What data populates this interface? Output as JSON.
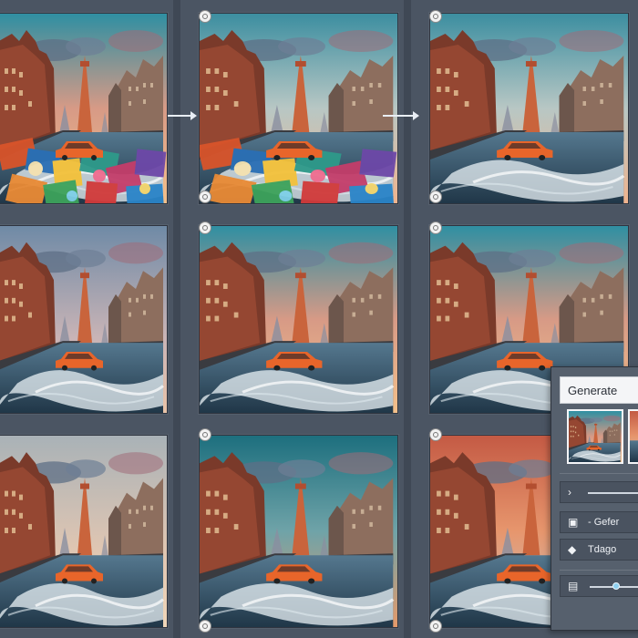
{
  "panel": {
    "title": "Generate",
    "rows": [
      {
        "icon": "chevron-right-icon",
        "label": ""
      },
      {
        "icon": "image-frame-icon",
        "label": "- Gefer"
      },
      {
        "icon": "diamond-split-icon",
        "label": "Tdago"
      },
      {
        "icon": "slider-icon",
        "label": ""
      }
    ],
    "slider_value": 0.45
  },
  "grid": {
    "rows": 3,
    "cols": 3,
    "tiles": [
      {
        "variant": "collage-source"
      },
      {
        "variant": "collage-blend"
      },
      {
        "variant": "teal-sky"
      },
      {
        "variant": "dusk"
      },
      {
        "variant": "sunset"
      },
      {
        "variant": "sunset"
      },
      {
        "variant": "pale"
      },
      {
        "variant": "deep-teal"
      },
      {
        "variant": "warm-cloud"
      }
    ]
  },
  "colors": {
    "background": "#4e5866",
    "taxi": "#e8652a",
    "water": "#3b5f7a",
    "sky_teal": "#4fa7b6",
    "sky_orange": "#f0a070"
  }
}
